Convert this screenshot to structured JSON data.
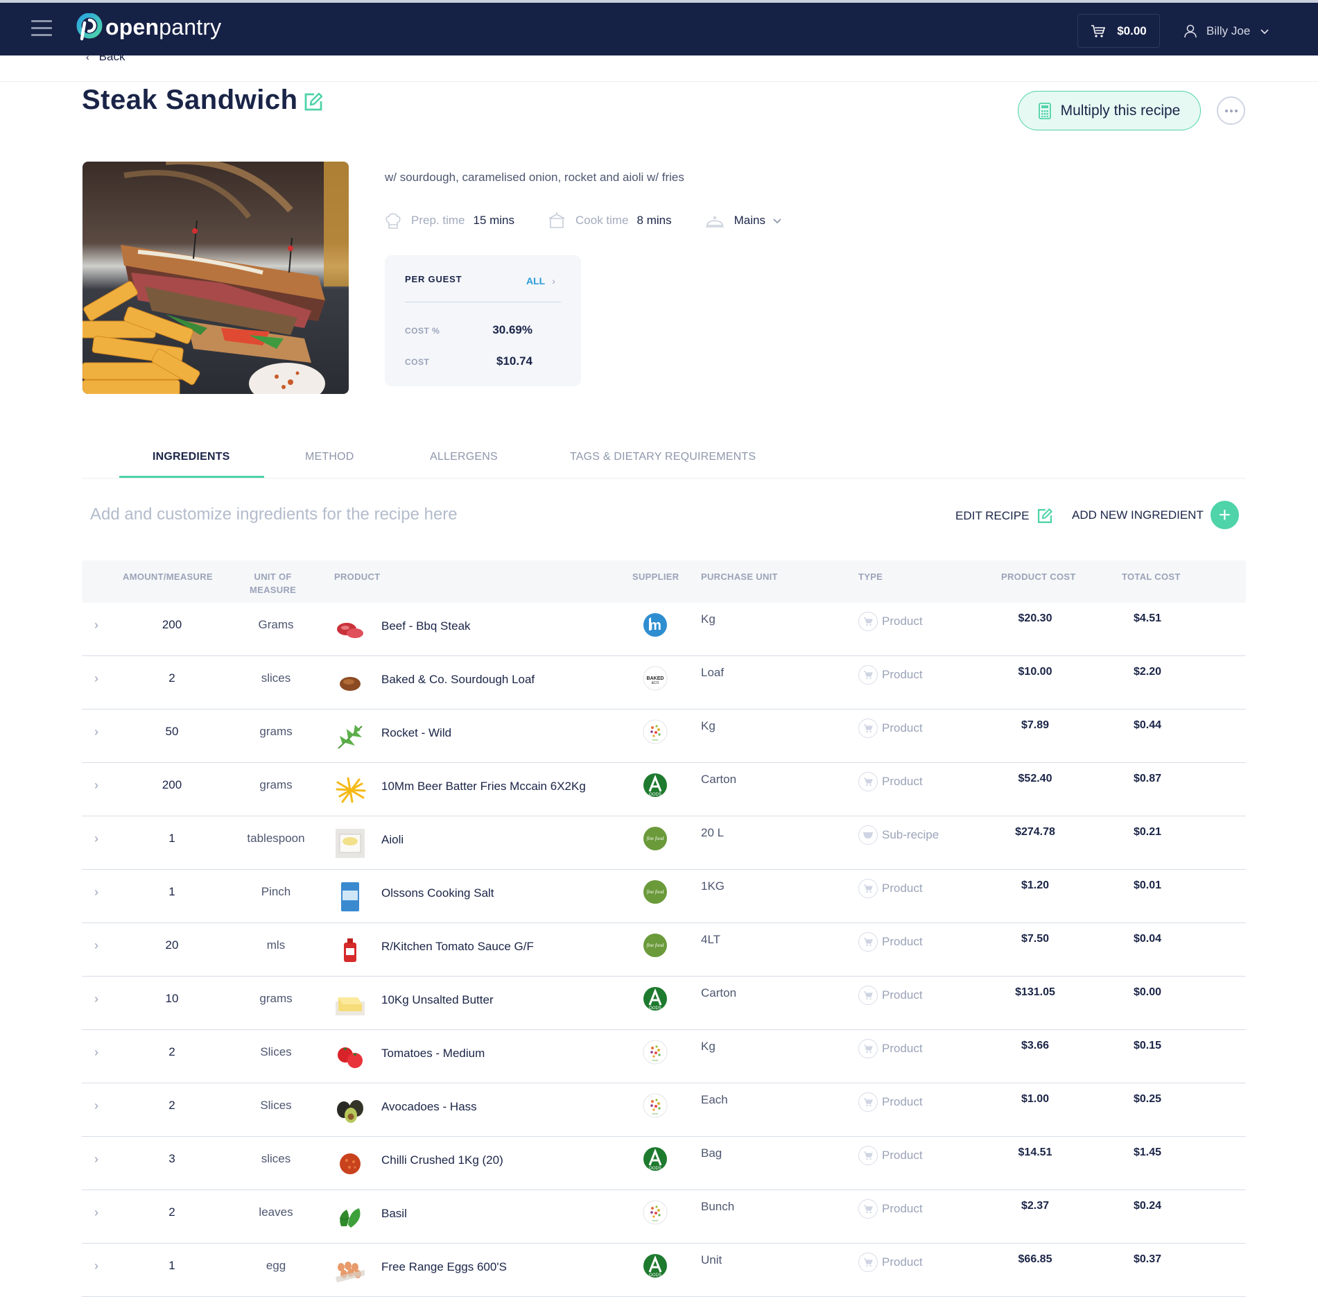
{
  "app": {
    "brand_bold": "open",
    "brand_light": "pantry",
    "cart_total": "$0.00",
    "user_name": "Billy Joe"
  },
  "nav": {
    "back_label": "Back"
  },
  "recipe": {
    "title": "Steak Sandwich",
    "subtitle": "w/ sourdough, caramelised onion, rocket and aioli w/ fries",
    "prep_label": "Prep. time",
    "prep_value": "15 mins",
    "cook_label": "Cook time",
    "cook_value": "8 mins",
    "course": "Mains",
    "multiply_label": "Multiply this recipe"
  },
  "per_guest": {
    "header": "PER GUEST",
    "all_label": "ALL",
    "cost_pct_label": "COST %",
    "cost_pct_value": "30.69%",
    "cost_label": "COST",
    "cost_value": "$10.74"
  },
  "tabs": [
    {
      "label": "INGREDIENTS",
      "active": true
    },
    {
      "label": "METHOD",
      "active": false
    },
    {
      "label": "ALLERGENS",
      "active": false
    },
    {
      "label": "TAGS & DIETARY REQUIREMENTS",
      "active": false
    }
  ],
  "ingredients_panel": {
    "hint": "Add and customize ingredients for the recipe here",
    "edit_recipe_label": "EDIT RECIPE",
    "add_ingredient_label": "ADD NEW INGREDIENT"
  },
  "table": {
    "headers": {
      "amount": "AMOUNT/MEASURE",
      "unit_line1": "UNIT OF",
      "unit_line2": "MEASURE",
      "product": "PRODUCT",
      "supplier": "SUPPLIER",
      "purchase_unit": "PURCHASE UNIT",
      "type": "TYPE",
      "product_cost": "PRODUCT COST",
      "total_cost": "TOTAL COST"
    },
    "rows": [
      {
        "amount": "200",
        "unit": "Grams",
        "product": "Beef - Bbq Steak",
        "thumb": "beef",
        "supplier": "hm",
        "purchase_unit": "Kg",
        "type": "Product",
        "product_cost": "$20.30",
        "total_cost": "$4.51"
      },
      {
        "amount": "2",
        "unit": "slices",
        "product": "Baked & Co. Sourdough Loaf",
        "thumb": "bread",
        "supplier": "baked",
        "purchase_unit": "Loaf",
        "type": "Product",
        "product_cost": "$10.00",
        "total_cost": "$2.20"
      },
      {
        "amount": "50",
        "unit": "grams",
        "product": "Rocket - Wild",
        "thumb": "rocket",
        "supplier": "fresh",
        "purchase_unit": "Kg",
        "type": "Product",
        "product_cost": "$7.89",
        "total_cost": "$0.44"
      },
      {
        "amount": "200",
        "unit": "grams",
        "product": "10Mm Beer Batter Fries Mccain 6X2Kg",
        "thumb": "fries",
        "supplier": "afoods",
        "purchase_unit": "Carton",
        "type": "Product",
        "product_cost": "$52.40",
        "total_cost": "$0.87"
      },
      {
        "amount": "1",
        "unit": "tablespoon",
        "product": "Aioli",
        "thumb": "aioli",
        "supplier": "finefood",
        "purchase_unit": "20 L",
        "type": "Sub-recipe",
        "product_cost": "$274.78",
        "total_cost": "$0.21"
      },
      {
        "amount": "1",
        "unit": "Pinch",
        "product": "Olssons Cooking Salt",
        "thumb": "salt",
        "supplier": "finefood",
        "purchase_unit": "1KG",
        "type": "Product",
        "product_cost": "$1.20",
        "total_cost": "$0.01"
      },
      {
        "amount": "20",
        "unit": "mls",
        "product": "R/Kitchen Tomato Sauce G/F",
        "thumb": "sauce",
        "supplier": "finefood",
        "purchase_unit": "4LT",
        "type": "Product",
        "product_cost": "$7.50",
        "total_cost": "$0.04"
      },
      {
        "amount": "10",
        "unit": "grams",
        "product": "10Kg Unsalted Butter",
        "thumb": "butter",
        "supplier": "afoods",
        "purchase_unit": "Carton",
        "type": "Product",
        "product_cost": "$131.05",
        "total_cost": "$0.00"
      },
      {
        "amount": "2",
        "unit": "Slices",
        "product": "Tomatoes - Medium",
        "thumb": "tomato",
        "supplier": "fresh",
        "purchase_unit": "Kg",
        "type": "Product",
        "product_cost": "$3.66",
        "total_cost": "$0.15"
      },
      {
        "amount": "2",
        "unit": "Slices",
        "product": "Avocadoes - Hass",
        "thumb": "avocado",
        "supplier": "fresh",
        "purchase_unit": "Each",
        "type": "Product",
        "product_cost": "$1.00",
        "total_cost": "$0.25"
      },
      {
        "amount": "3",
        "unit": "slices",
        "product": "Chilli Crushed 1Kg (20)",
        "thumb": "chilli",
        "supplier": "afoods",
        "purchase_unit": "Bag",
        "type": "Product",
        "product_cost": "$14.51",
        "total_cost": "$1.45"
      },
      {
        "amount": "2",
        "unit": "leaves",
        "product": "Basil",
        "thumb": "basil",
        "supplier": "fresh",
        "purchase_unit": "Bunch",
        "type": "Product",
        "product_cost": "$2.37",
        "total_cost": "$0.24"
      },
      {
        "amount": "1",
        "unit": "egg",
        "product": "Free Range Eggs 600'S",
        "thumb": "eggs",
        "supplier": "afoods",
        "purchase_unit": "Unit",
        "type": "Product",
        "product_cost": "$66.85",
        "total_cost": "$0.37"
      }
    ]
  },
  "colors": {
    "navy": "#162146",
    "accent_green": "#4fd3a9",
    "link_blue": "#2a9ad6"
  }
}
